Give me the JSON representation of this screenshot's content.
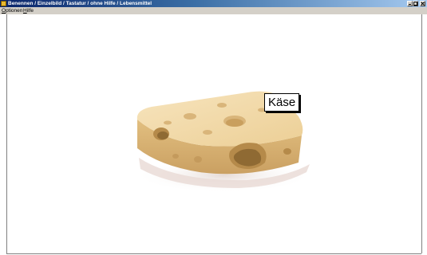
{
  "window": {
    "title": "Benennen / Einzelbild / Tastatur / ohne Hilfe / Lebensmittel",
    "controls": [
      "minimize",
      "maximize",
      "close"
    ]
  },
  "menu": [
    {
      "accel": "O",
      "rest": "ptionen"
    },
    {
      "accel": "H",
      "rest": "ilfe"
    }
  ],
  "stimulus": {
    "image": "cheese-icon",
    "word": "Käse"
  }
}
